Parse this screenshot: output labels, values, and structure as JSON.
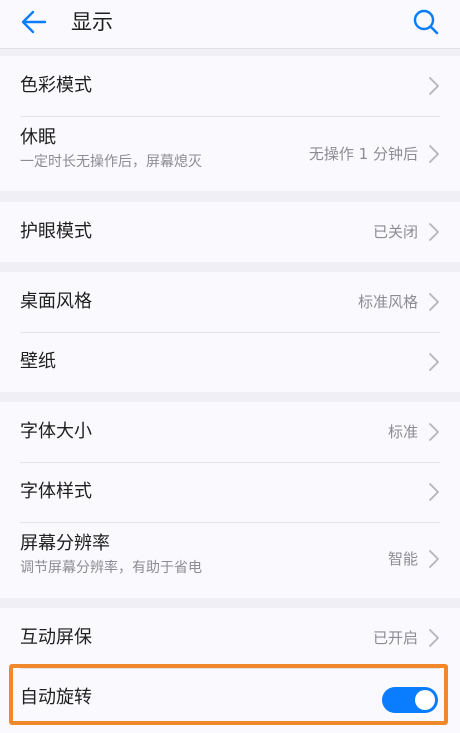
{
  "header": {
    "title": "显示",
    "back_icon": "arrow-left-icon",
    "search_icon": "search-icon"
  },
  "colors": {
    "accent": "#0a7dff",
    "highlight_border": "#f0892b",
    "background": "#f0eff5",
    "card": "#faf9fd"
  },
  "groups": [
    {
      "items": [
        {
          "title": "色彩模式",
          "value": "",
          "subtitle": ""
        },
        {
          "title": "休眠",
          "value": "无操作 1 分钟后",
          "subtitle": "一定时长无操作后，屏幕熄灭"
        }
      ]
    },
    {
      "items": [
        {
          "title": "护眼模式",
          "value": "已关闭",
          "subtitle": ""
        }
      ]
    },
    {
      "items": [
        {
          "title": "桌面风格",
          "value": "标准风格",
          "subtitle": ""
        },
        {
          "title": "壁纸",
          "value": "",
          "subtitle": ""
        }
      ]
    },
    {
      "items": [
        {
          "title": "字体大小",
          "value": "标准",
          "subtitle": ""
        },
        {
          "title": "字体样式",
          "value": "",
          "subtitle": ""
        },
        {
          "title": "屏幕分辨率",
          "value": "智能",
          "subtitle": "调节屏幕分辨率，有助于省电"
        }
      ]
    },
    {
      "items": [
        {
          "title": "互动屏保",
          "value": "已开启",
          "subtitle": ""
        },
        {
          "title": "自动旋转",
          "toggle": true,
          "subtitle": ""
        }
      ]
    }
  ]
}
